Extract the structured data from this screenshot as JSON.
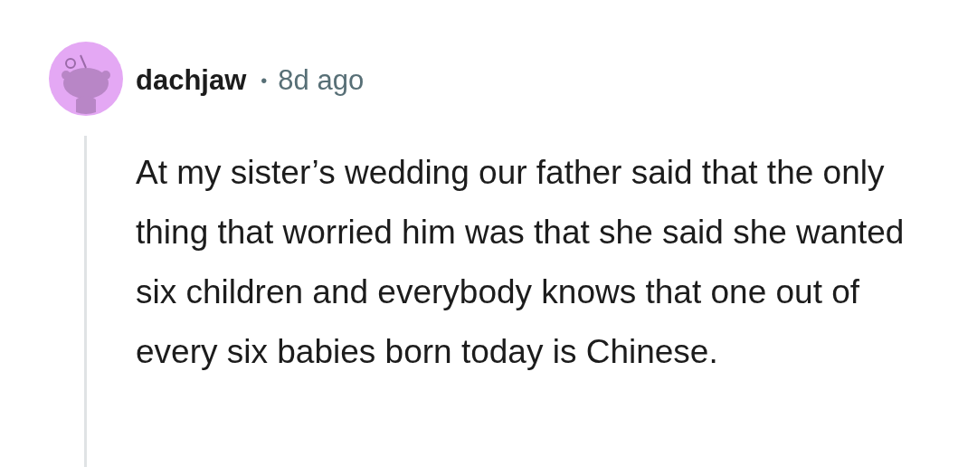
{
  "comment": {
    "author": "dachjaw",
    "separator": "•",
    "time": "8d ago",
    "body": "At my sister’s wedding our father said that the only thing that worried him was that she said she wanted six children and everybody knows that one out of every six babies born today is Chinese."
  }
}
